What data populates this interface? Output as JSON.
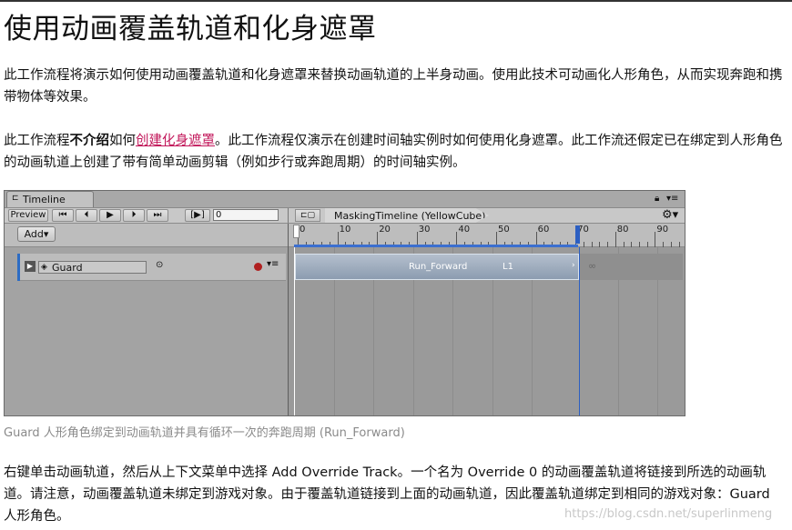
{
  "page": {
    "title": "使用动画覆盖轨道和化身遮罩",
    "para1": "此工作流程将演示如何使用动画覆盖轨道和化身遮罩来替换动画轨道的上半身动画。使用此技术可动画化人形角色，从而实现奔跑和携带物体等效果。",
    "para2_a": "此工作流程",
    "para2_bold": "不介绍",
    "para2_b": "如何",
    "para2_link": "创建化身遮罩",
    "para2_c": "。此工作流程仅演示在创建时间轴实例时如何使用化身遮罩。此工作流还假定已在绑定到人形角色的动画轨道上创建了带有简单动画剪辑（例如步行或奔跑周期）的时间轴实例。",
    "caption": "Guard 人形角色绑定到动画轨道并具有循环一次的奔跑周期 (Run_Forward)",
    "para3": "右键单击动画轨道，然后从上下文菜单中选择 Add Override Track。一个名为 Override 0 的动画覆盖轨道将链接到所选的动画轨道。请注意，动画覆盖轨道未绑定到游戏对象。由于覆盖轨道链接到上面的动画轨道，因此覆盖轨道绑定到相同的游戏对象：Guard 人形角色。",
    "watermark": "https://blog.csdn.net/superlinmeng"
  },
  "timeline": {
    "tab_label": "Timeline",
    "preview_label": "Preview",
    "buttons": [
      "⏮",
      "⏴",
      "▶",
      "⏵",
      "⏭",
      "[▶]"
    ],
    "frame_value": "0",
    "breadcrumb": "MaskingTimeline (YellowCube)",
    "add_label": "Add▾",
    "ruler_labels": [
      "0",
      "10",
      "20",
      "30",
      "40",
      "50",
      "60",
      "70",
      "80",
      "90"
    ],
    "track": {
      "name": "Guard",
      "clip_name": "Run_Forward",
      "clip_suffix": "L1"
    },
    "colors": {
      "accent": "#2c6cc4",
      "record": "#b02020",
      "link": "#c2185b"
    }
  }
}
